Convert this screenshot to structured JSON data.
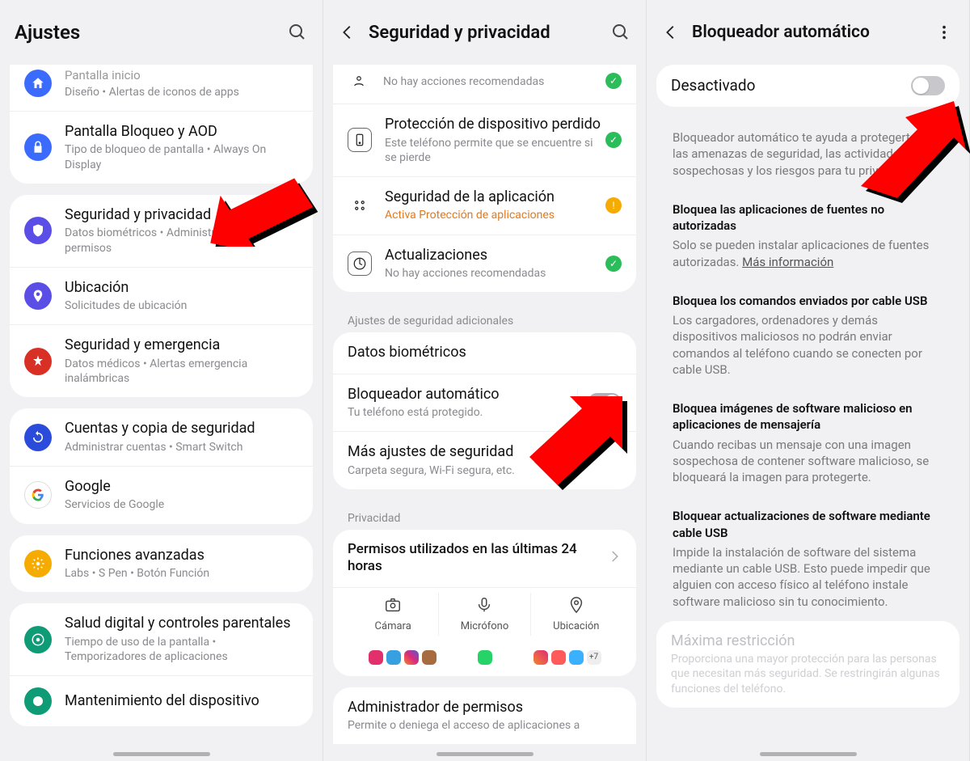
{
  "s1": {
    "title": "Ajustes",
    "rows": {
      "r0_title": "Pantalla inicio",
      "r0_sub": "Diseño  •  Alertas de iconos de apps",
      "r1_title": "Pantalla Bloqueo y AOD",
      "r1_sub": "Tipo de bloqueo de pantalla  •  Always On Display",
      "r2_title": "Seguridad y privacidad",
      "r2_sub": "Datos biométricos  •  Administrador de permisos",
      "r3_title": "Ubicación",
      "r3_sub": "Solicitudes de ubicación",
      "r4_title": "Seguridad y emergencia",
      "r4_sub": "Datos médicos  •  Alertas emergencia inalámbricas",
      "r5_title": "Cuentas y copia de seguridad",
      "r5_sub": "Administrar cuentas  •  Smart Switch",
      "r6_title": "Google",
      "r6_sub": "Servicios de Google",
      "r7_title": "Funciones avanzadas",
      "r7_sub": "Labs  •  S Pen  •  Botón Función",
      "r8_title": "Salud digital y controles parentales",
      "r8_sub": "Tiempo de uso de la pantalla  •  Temporizadores de aplicaciones",
      "r9_title": "Mantenimiento del dispositivo"
    }
  },
  "s2": {
    "title": "Seguridad y privacidad",
    "rows": {
      "top_sub": "No hay acciones recomendadas",
      "r1_title": "Protección de dispositivo perdido",
      "r1_sub": "Este teléfono permite que se encuentre si se pierde",
      "r2_title": "Seguridad de la aplicación",
      "r2_sub": "Activa Protección de aplicaciones",
      "r3_title": "Actualizaciones",
      "r3_sub": "No hay acciones recomendadas",
      "sh1": "Ajustes de seguridad adicionales",
      "r4_title": "Datos biométricos",
      "r5_title": "Bloqueador automático",
      "r5_sub": "Tu teléfono está protegido.",
      "r6_title": "Más ajustes de seguridad",
      "r6_sub": "Carpeta segura, Wi-Fi segura, etc.",
      "sh2": "Privacidad",
      "r7_title": "Permisos utilizados en las últimas 24 horas",
      "perm1": "Cámara",
      "perm2": "Micrófono",
      "perm3": "Ubicación",
      "plus": "+7",
      "r8_title": "Administrador de permisos",
      "r8_sub": "Permite o deniega el acceso de aplicaciones a"
    }
  },
  "s3": {
    "title": "Bloqueador automático",
    "toggle_label": "Desactivado",
    "intro": "Bloqueador automático te ayuda a protegerte de las amenazas de seguridad, las actividades sospechosas y los riesgos para tu privacidad.",
    "b1_h": "Bloquea las aplicaciones de fuentes no autorizadas",
    "b1_p": "Solo se pueden instalar aplicaciones de fuentes autorizadas. ",
    "b1_link": "Más información",
    "b2_h": "Bloquea los comandos enviados por cable USB",
    "b2_p": "Los cargadores, ordenadores y demás dispositivos maliciosos no podrán enviar comandos al teléfono cuando se conecten por cable USB.",
    "b3_h": "Bloquea imágenes de software malicioso en aplicaciones de mensajería",
    "b3_p": "Cuando recibas un mensaje con una imagen sospechosa de contener software malicioso, se bloqueará la imagen para protegerte.",
    "b4_h": "Bloquear actualizaciones de software mediante cable USB",
    "b4_p": "Impide la instalación de software del sistema mediante un cable USB. Esto puede impedir que alguien con acceso físico al teléfono instale software malicioso sin tu conocimiento.",
    "max_title": "Máxima restricción",
    "max_sub": "Proporciona una mayor protección para las personas que necesitan más seguridad. Se restringirán algunas funciones del teléfono."
  }
}
